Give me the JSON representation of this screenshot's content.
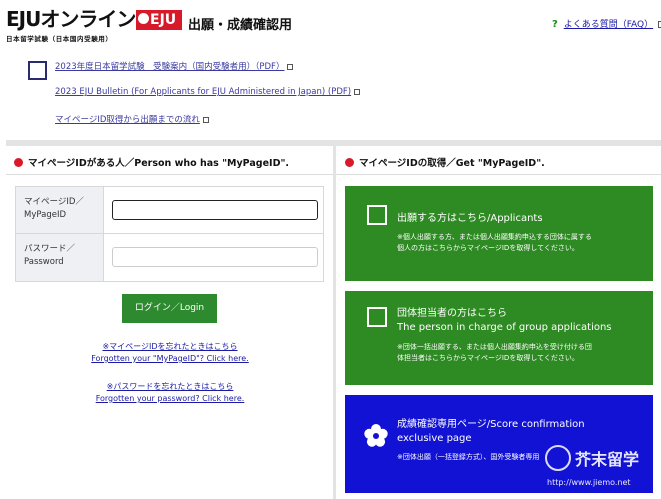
{
  "header": {
    "logo_main": "EJUオンライン",
    "logo_badge": "EJU",
    "logo_sub": "日本留学試験（日本国内受験用）",
    "page_heading": "出願・成績確認用",
    "faq_label": "よくある質問（FAQ）",
    "faq_mark": "?"
  },
  "links": [
    {
      "label": "2023年度日本留学試験　受験案内（国内受験者用）（PDF）"
    },
    {
      "label": "2023 EJU Bulletin (For Applicants for EJU Administered in Japan) (PDF)"
    },
    {
      "label": "マイページID取得から出願までの流れ"
    }
  ],
  "left": {
    "section_title": "マイページIDがある人／Person who has \"MyPageID\".",
    "id_label_line1": "マイページID／",
    "id_label_line2": "MyPageID",
    "pw_label_line1": "パスワード／",
    "pw_label_line2": "Password",
    "id_value": "",
    "pw_value": "",
    "login_label": "ログイン／Login",
    "forgot_id_line1": "※マイページIDを忘れたときはこちら",
    "forgot_id_line2": "Forgotten your \"MyPageID\"? Click here.",
    "forgot_pw_line1": "※パスワードを忘れたときはこちら",
    "forgot_pw_line2": "Forgotten your password? Click here."
  },
  "right": {
    "section_title": "マイページIDの取得／Get \"MyPageID\".",
    "cards": [
      {
        "title_line1": "出願する方はこちら/Applicants",
        "title_line2": "",
        "desc_line1": "※個人出願する方、または個人出願集約申込する団体に属する",
        "desc_line2": "個人の方はこちらからマイページIDを取得してください。"
      },
      {
        "title_line1": "団体担当者の方はこちら",
        "title_line2": "The person in charge of group applications",
        "desc_line1": "※団体一括出願する、または個人出願集約申込を受け付ける団",
        "desc_line2": "体担当者はこちらからマイページIDを取得してください。"
      },
      {
        "title_line1": "成績確認専用ページ/Score confirmation",
        "title_line2": "exclusive page",
        "desc_line1": "※団体出願（一括登録方式）、国外受験者専用",
        "desc_line2": ""
      }
    ]
  },
  "watermark": {
    "text": "芥末留学",
    "url": "http://www.jiemo.net"
  },
  "colors": {
    "accent_red": "#d8192a",
    "card_green": "#2e8a22",
    "card_blue": "#1212d4",
    "login_green": "#2e8a2e",
    "link_blue": "#3a3aa0"
  }
}
